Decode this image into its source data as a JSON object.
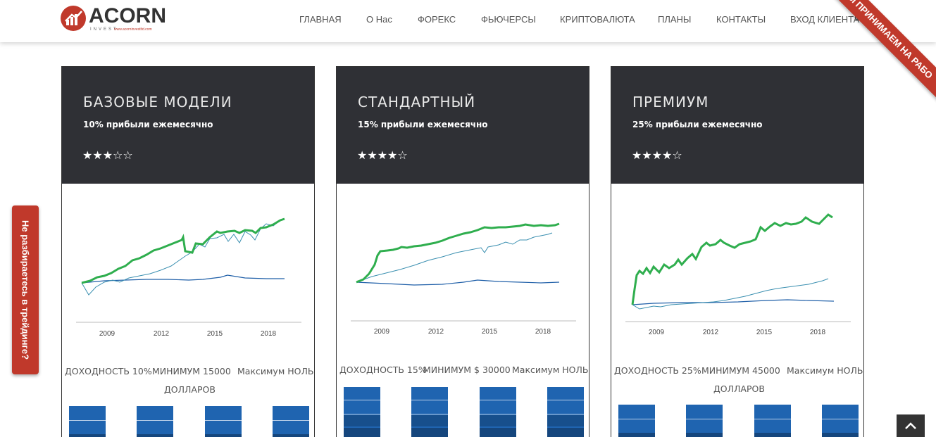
{
  "brand": {
    "logo_text": "ACORN",
    "logo_sub": "INVEST",
    "logo_url": "www.acorninvestltd.com",
    "accent_color": "#c0392b"
  },
  "nav": {
    "items": [
      {
        "label": "ГЛАВНАЯ"
      },
      {
        "label": "О Нас"
      },
      {
        "label": "ФОРЕКС"
      },
      {
        "label": "ФЬЮЧЕРСЫ"
      },
      {
        "label": "КРИПТОВАЛЮТА"
      },
      {
        "label": "ПЛАНЫ"
      },
      {
        "label": "КОНТАКТЫ"
      },
      {
        "label": "ВХОД КЛИЕНТА"
      }
    ],
    "search_icon": "search-icon"
  },
  "ribbon": {
    "text": "ЫЫ ПРИНИМАЕМ НА РАБО"
  },
  "side_tab": {
    "label": "Не разбираетесь в трейдинге?"
  },
  "plans": [
    {
      "title": "БАЗОВЫЕ МОДЕЛИ",
      "profit": "10% прибыли ежемесячно",
      "rating": 3,
      "rating_max": 5,
      "stars": "★★★☆☆",
      "chart": {
        "x_ticks": [
          "2009",
          "2012",
          "2015",
          "2018"
        ]
      },
      "stats": {
        "yield": "ДОХОДНОСТЬ 10%",
        "minimum": "МИНИМУМ 15000",
        "maximum": "Максимум НОЛЬ",
        "currency": "ДОЛЛАРОВ"
      }
    },
    {
      "title": "СТАНДАРТНЫЙ",
      "profit": "15% прибыли ежемесячно",
      "rating": 4,
      "rating_max": 5,
      "stars": "★★★★☆",
      "chart": {
        "x_ticks": [
          "2009",
          "2012",
          "2015",
          "2018"
        ]
      },
      "stats": {
        "yield": "ДОХОДНОСТЬ 15%",
        "minimum": "МИНИМУМ $ 30000",
        "maximum": "Максимум НОЛЬ",
        "currency": ""
      }
    },
    {
      "title": "ПРЕМИУМ",
      "profit": "25% прибыли ежемесячно",
      "rating": 4,
      "rating_max": 5,
      "stars": "★★★★☆",
      "chart": {
        "x_ticks": [
          "2009",
          "2012",
          "2015",
          "2018"
        ]
      },
      "stats": {
        "yield": "ДОХОДНОСТЬ 25%",
        "minimum": "МИНИМУМ 45000",
        "maximum": "Максимум НОЛЬ",
        "currency": "ДОЛЛАРОВ"
      }
    }
  ],
  "scroll_top": {
    "icon": "chevron-up-icon"
  }
}
